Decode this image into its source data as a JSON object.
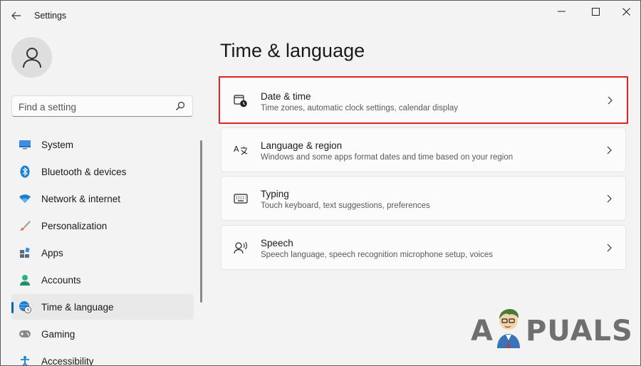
{
  "window": {
    "title": "Settings",
    "controls": [
      "minimize-icon",
      "maximize-icon",
      "close-icon"
    ]
  },
  "search": {
    "placeholder": "Find a setting",
    "value": ""
  },
  "sidebar": {
    "items": [
      {
        "label": "System",
        "icon": "system-icon",
        "color": "#2d7bd6"
      },
      {
        "label": "Bluetooth & devices",
        "icon": "bluetooth-icon",
        "color": "#1a7fd4"
      },
      {
        "label": "Network & internet",
        "icon": "wifi-icon",
        "color": "#1a7fd4"
      },
      {
        "label": "Personalization",
        "icon": "brush-icon",
        "color": "#e07b39"
      },
      {
        "label": "Apps",
        "icon": "apps-icon",
        "color": "#5a6b7c"
      },
      {
        "label": "Accounts",
        "icon": "person-icon",
        "color": "#2cb08a"
      },
      {
        "label": "Time & language",
        "icon": "globe-clock-icon",
        "color": "#1a7fd4",
        "selected": true
      },
      {
        "label": "Gaming",
        "icon": "gamepad-icon",
        "color": "#7a7a7a"
      },
      {
        "label": "Accessibility",
        "icon": "accessibility-icon",
        "color": "#1a7fd4"
      }
    ]
  },
  "main": {
    "title": "Time & language",
    "cards": [
      {
        "title": "Date & time",
        "subtitle": "Time zones, automatic clock settings, calendar display",
        "icon": "calendar-clock-icon",
        "highlighted": true
      },
      {
        "title": "Language & region",
        "subtitle": "Windows and some apps format dates and time based on your region",
        "icon": "language-icon"
      },
      {
        "title": "Typing",
        "subtitle": "Touch keyboard, text suggestions, preferences",
        "icon": "keyboard-icon"
      },
      {
        "title": "Speech",
        "subtitle": "Speech language, speech recognition microphone setup, voices",
        "icon": "speech-icon"
      }
    ]
  },
  "watermark": {
    "text_left": "A",
    "text_right": "PUALS"
  },
  "colors": {
    "accent": "#0067c0",
    "highlight_border": "#e02424",
    "background": "#f3f3f3"
  }
}
